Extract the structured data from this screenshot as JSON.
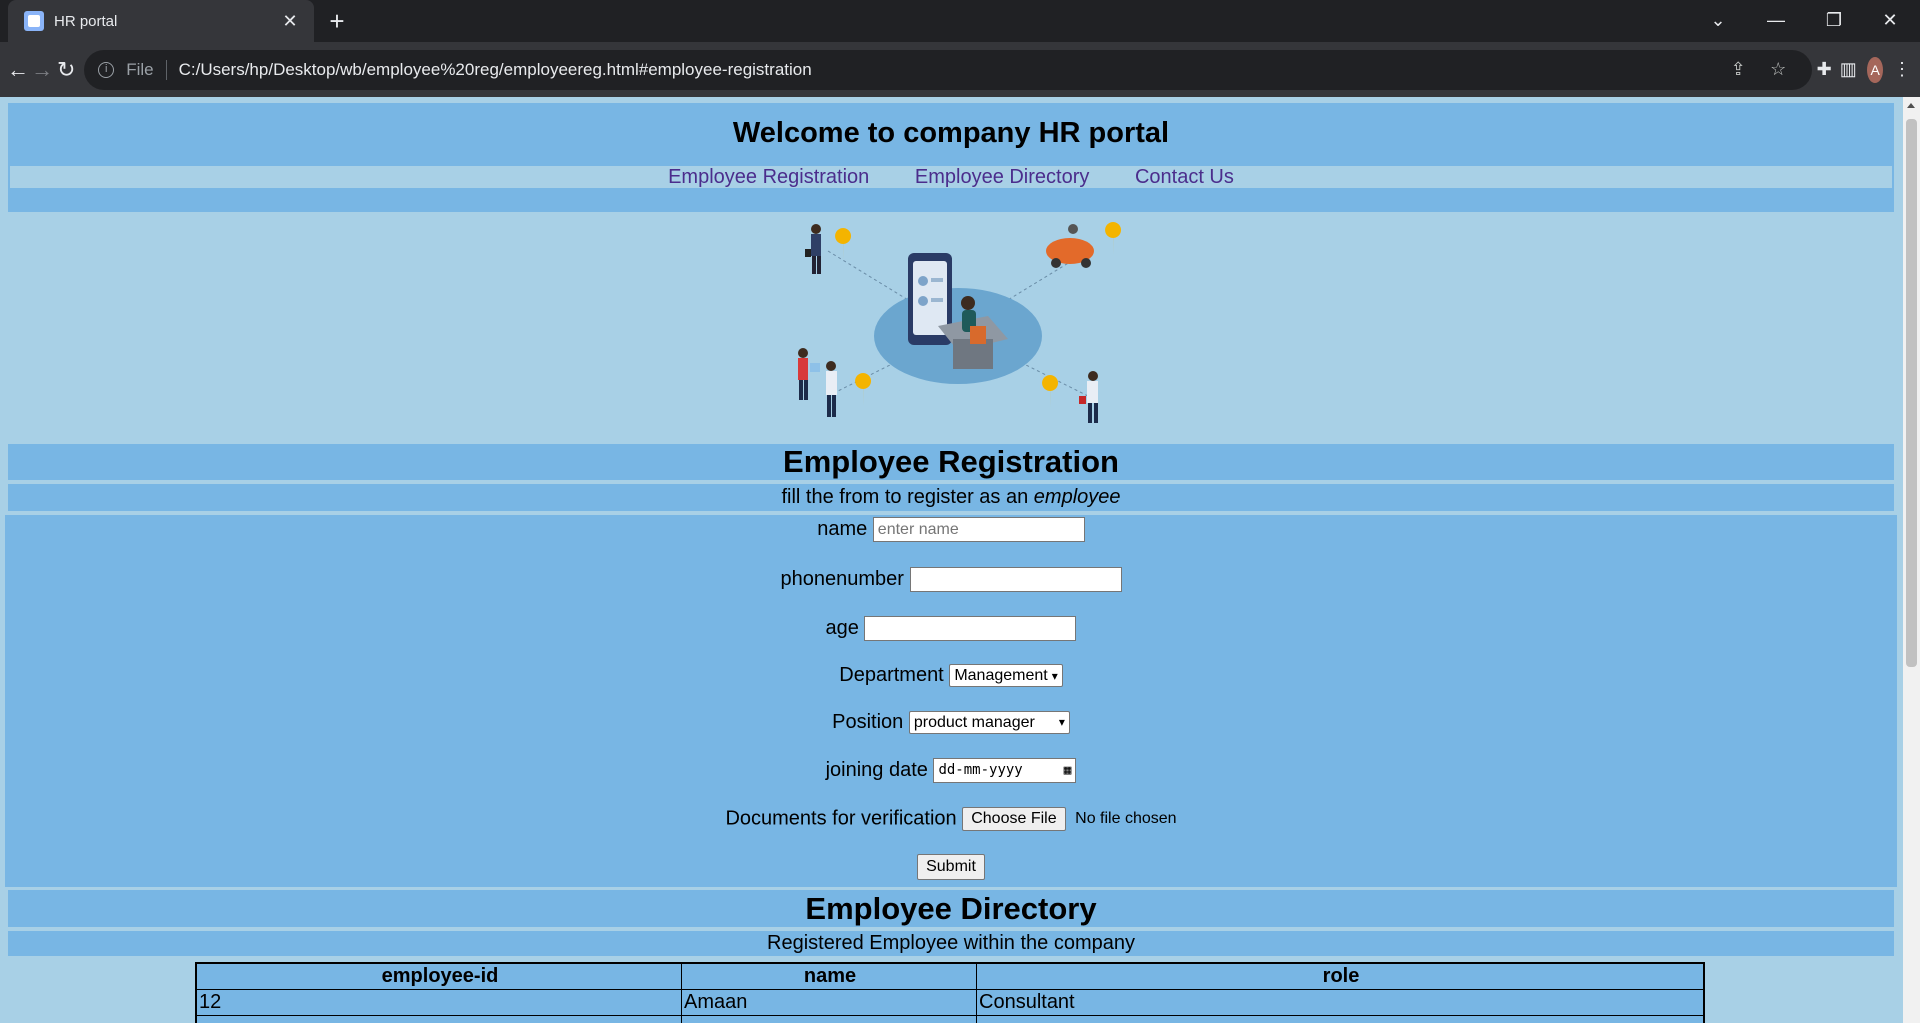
{
  "browser": {
    "tab_title": "HR portal",
    "file_label": "File",
    "url": "C:/Users/hp/Desktop/wb/employee%20reg/employeereg.html#employee-registration",
    "profile_initial": "A"
  },
  "header": {
    "title": "Welcome to company HR portal",
    "nav": [
      "Employee Registration",
      "Employee Directory",
      "Contact Us"
    ]
  },
  "registration": {
    "title": "Employee Registration",
    "subtitle_prefix": "fill the from to register as an ",
    "subtitle_emphasis": "employee",
    "fields": {
      "name_label": "name",
      "name_placeholder": "enter name",
      "phone_label": "phonenumber",
      "age_label": "age",
      "department_label": "Department",
      "department_value": "Management",
      "position_label": "Position",
      "position_value": "product manager",
      "date_label": "joining date",
      "date_placeholder": "dd-mm-yyyy",
      "docs_label": "Documents for verification",
      "choose_file": "Choose File",
      "no_file": "No file chosen"
    },
    "submit": "Submit"
  },
  "directory": {
    "title": "Employee Directory",
    "subtitle": "Registered Employee within the company",
    "columns": [
      "employee-id",
      "name",
      "role"
    ],
    "rows": [
      [
        "12",
        "Amaan",
        "Consultant"
      ]
    ]
  },
  "colors": {
    "band": "#78b6e4",
    "background": "#a8d0e6",
    "link": "#4b2d8c"
  }
}
